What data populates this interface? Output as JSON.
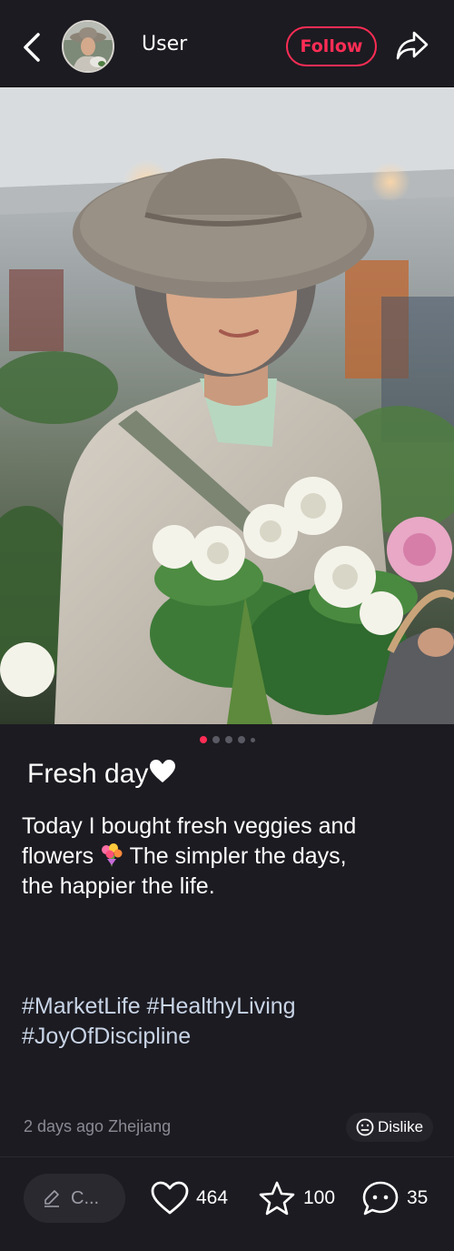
{
  "header": {
    "username": "User",
    "follow_label": "Follow"
  },
  "gallery": {
    "slide_count": 5,
    "active_index": 0
  },
  "post": {
    "title": "Fresh day",
    "title_emoji": "white-heart-icon",
    "body_line1": "Today I bought fresh veggies and",
    "body_line2_before": "flowers",
    "body_emoji": "bouquet-icon",
    "body_line2_after": " The simpler the days,",
    "body_line3": "the happier the life.",
    "tags_line1": "#MarketLife #HealthyLiving",
    "tags_line2": "#JoyOfDiscipline",
    "meta": "2 days ago Zhejiang",
    "dislike_label": "Dislike"
  },
  "actions": {
    "comment_placeholder": "C...",
    "likes": "464",
    "stars": "100",
    "comments": "35"
  },
  "colors": {
    "accent": "#ff2d55",
    "background": "#1c1b21",
    "tag_color": "#c8d4e6"
  }
}
